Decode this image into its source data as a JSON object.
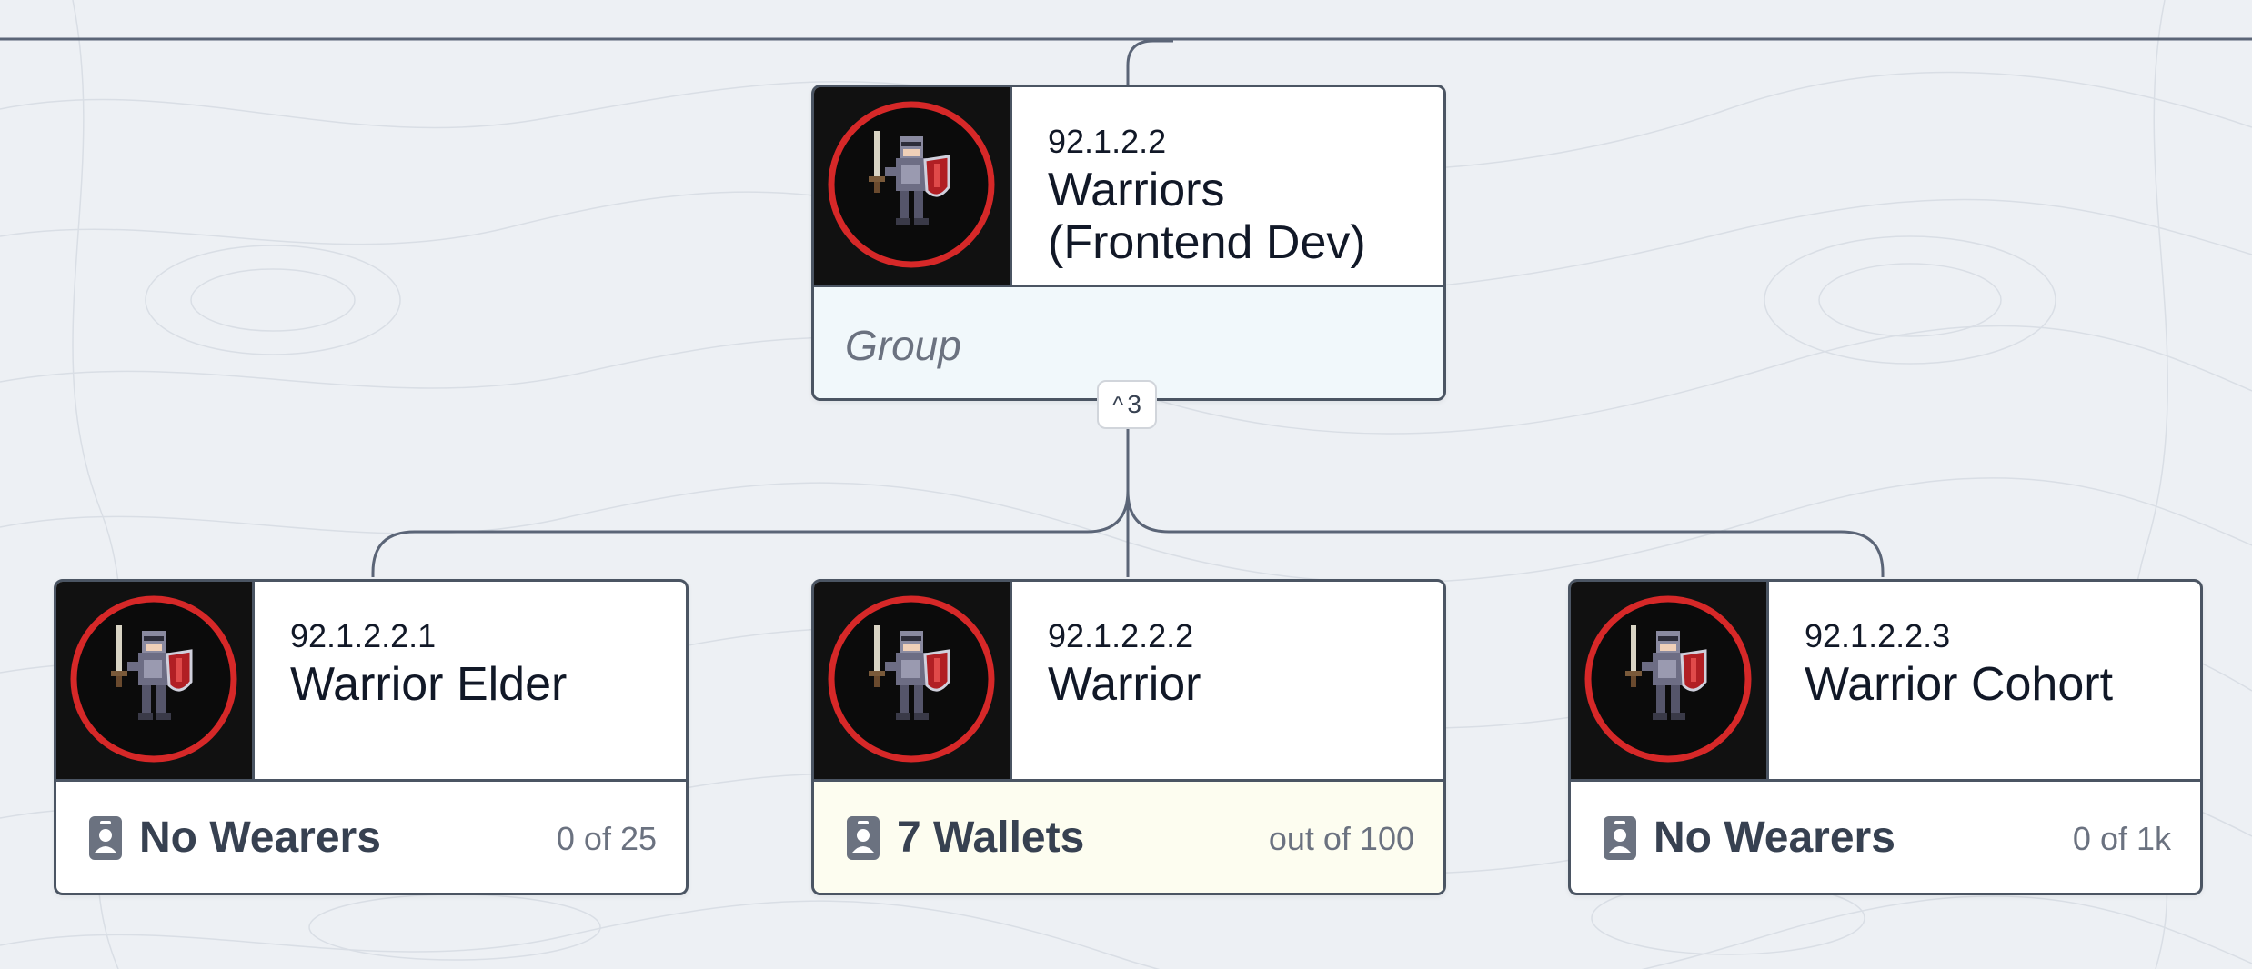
{
  "tree": {
    "parent": {
      "hat_id": "92.1.2.2",
      "name": "Warriors (Frontend Dev)",
      "footer_label": "Group",
      "avatar_icon": "warrior-knight-icon"
    },
    "collapse_toggle": {
      "chevron": "^",
      "count": "3"
    },
    "children": [
      {
        "hat_id": "92.1.2.2.1",
        "name": "Warrior Elder",
        "wearers_label": "No Wearers",
        "max_label": "0 of 25",
        "avatar_icon": "warrior-knight-icon"
      },
      {
        "hat_id": "92.1.2.2.2",
        "name": "Warrior",
        "wearers_label": "7 Wallets",
        "max_label": "out of 100",
        "avatar_icon": "warrior-knight-icon"
      },
      {
        "hat_id": "92.1.2.2.3",
        "name": "Warrior Cohort",
        "wearers_label": "No Wearers",
        "max_label": "0 of 1k",
        "avatar_icon": "warrior-knight-icon"
      }
    ]
  },
  "colors": {
    "background": "#edf0f4",
    "card_border": "#4b5563",
    "avatar_ring": "#d62828",
    "group_footer": "#f1f8fb",
    "filled_footer": "#fdfdf0",
    "connector": "#5b6577"
  }
}
